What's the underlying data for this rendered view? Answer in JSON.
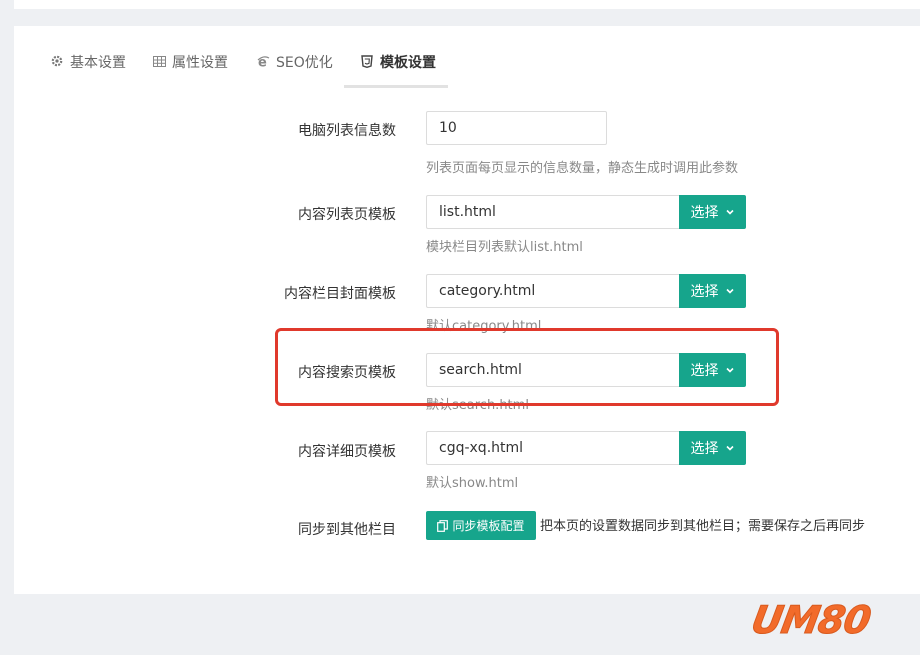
{
  "tabs": [
    {
      "label": "基本设置",
      "icon": "gear-icon",
      "active": false
    },
    {
      "label": "属性设置",
      "icon": "table-icon",
      "active": false
    },
    {
      "label": "SEO优化",
      "icon": "ie-icon",
      "active": false
    },
    {
      "label": "模板设置",
      "icon": "html5-icon",
      "active": true
    }
  ],
  "form": {
    "list_count": {
      "label": "电脑列表信息数",
      "value": "10",
      "hint": "列表页面每页显示的信息数量，静态生成时调用此参数"
    },
    "list_template": {
      "label": "内容列表页模板",
      "value": "list.html",
      "button": "选择",
      "hint": "模块栏目列表默认list.html"
    },
    "category_template": {
      "label": "内容栏目封面模板",
      "value": "category.html",
      "button": "选择",
      "hint": "默认category.html"
    },
    "search_template": {
      "label": "内容搜索页模板",
      "value": "search.html",
      "button": "选择",
      "hint": "默认search.html"
    },
    "show_template": {
      "label": "内容详细页模板",
      "value": "cgq-xq.html",
      "button": "选择",
      "hint": "默认show.html"
    },
    "sync": {
      "label": "同步到其他栏目",
      "button": "同步模板配置",
      "text": "把本页的设置数据同步到其他栏目；需要保存之后再同步"
    }
  },
  "watermark": "UM80",
  "colors": {
    "accent": "#16a58c",
    "highlight": "#e0392c",
    "watermark": "#f26b2a"
  }
}
